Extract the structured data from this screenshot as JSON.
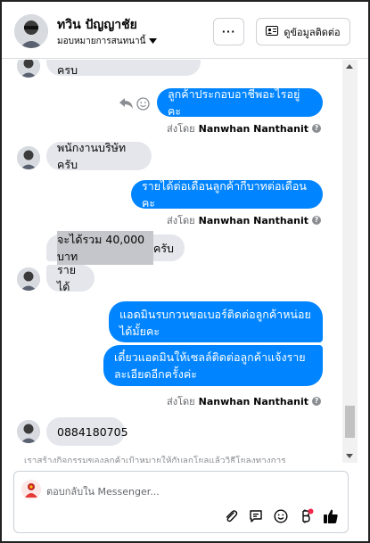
{
  "header": {
    "contact_name": "ทวิน ปัญญาชัย",
    "assignment": "มอบหมายการสนทนานี้",
    "more_label": "···",
    "contact_info_label": "ดูข้อมูลติดต่อ"
  },
  "messages": {
    "cut_top": "ถาจตนตองทายอาง เรยาจครบ",
    "out_1": "ลูกค้าประกอบอาชีพอะไรอยู่คะ",
    "in_1": "พนักงานบริษัทครับ",
    "out_2": "รายได้ต่อเดือนลูกค้ากี่บาทต่อเดือนคะ",
    "in_2_highlight": "จะได้รวม 40,000 บาท",
    "in_2_rest": "ครับ",
    "in_3": "รายได้",
    "out_3": "แอดมินรบกวนขอเบอร์ติดต่อลูกค้าหน่อยได้มั้ยคะ",
    "out_4": "เดี๋ยวแอดมินให้เซลล์ติดต่อลูกค้าแจ้งรายละเอียดอีกครั้งค่ะ",
    "in_4": "0884180705",
    "faded_bottom": "เราสร้างกิจกรรมของลูกค้าเป้าหมายให้กับลูกโยลแล้ววิธีโยลงทางการ"
  },
  "sent_by": {
    "prefix": "ส่งโดย",
    "agent": "Nanwhan Nanthanit"
  },
  "composer": {
    "placeholder": "ตอบกลับใน Messenger..."
  },
  "colors": {
    "outgoing": "#0084ff",
    "incoming": "#e4e6eb",
    "like": "#050505",
    "notification_dot": "#f02849"
  }
}
